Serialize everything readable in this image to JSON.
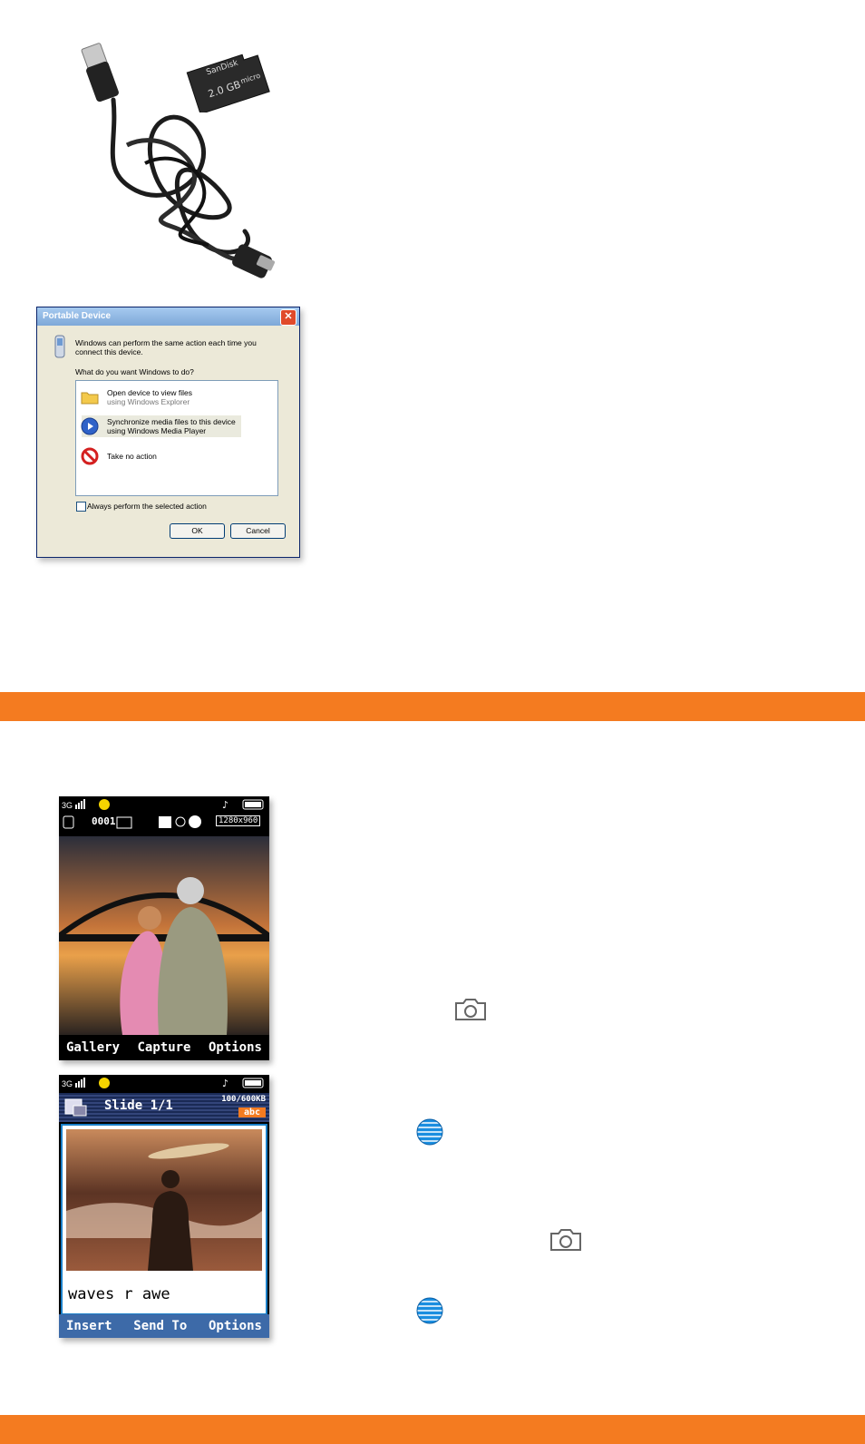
{
  "dialog": {
    "title": "Portable Device",
    "close_glyph": "✕",
    "intro": "Windows can perform the same action each time you connect this device.",
    "question": "What do you want Windows to do?",
    "options": [
      {
        "line1": "Open device to view files",
        "line2": "using Windows Explorer",
        "icon": "folder-icon"
      },
      {
        "line1": "Synchronize media files to this device",
        "line2": "using Windows Media Player",
        "icon": "media-player-icon"
      },
      {
        "line1": "Take no action",
        "line2": "",
        "icon": "no-action-icon"
      }
    ],
    "checkbox_label": "Always perform the selected action",
    "ok_label": "OK",
    "cancel_label": "Cancel"
  },
  "sd_card": {
    "brand": "SanDisk",
    "capacity": "2.0 GB",
    "type": "micro"
  },
  "camera_screen": {
    "resolution": "1280x960",
    "counter": "0001",
    "softkeys": [
      "Gallery",
      "Capture",
      "Options"
    ]
  },
  "message_screen": {
    "slide": "Slide 1/1",
    "size": "100/600KB",
    "mode": "abc",
    "text": "waves r awe",
    "softkeys": [
      "Insert",
      "Send To",
      "Options"
    ]
  },
  "colors": {
    "accent": "#f47b20",
    "phone_bg": "#000000",
    "msg_header": "#1a2a55"
  }
}
